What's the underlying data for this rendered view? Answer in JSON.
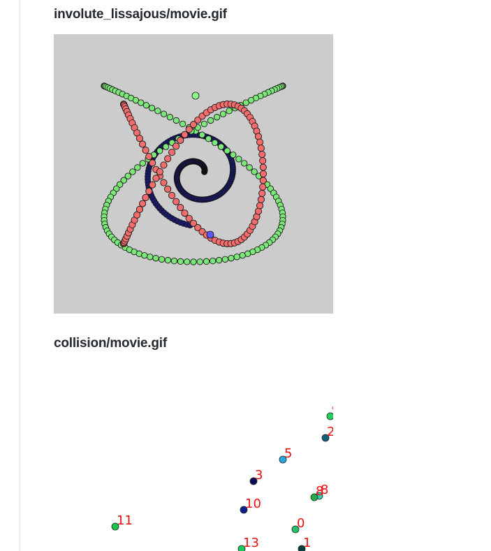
{
  "sections": [
    {
      "title": "involute_lissajous/movie.gif"
    },
    {
      "title": "collision/movie.gif"
    }
  ],
  "colors": {
    "frame_bg": "#cccccc",
    "red_dot": "#f26d6d",
    "green_dot": "#7de87a",
    "blue_dot": "#1b1b6b",
    "label_red": "#ee1111"
  },
  "particles": [
    {
      "label": "0",
      "fill": "#25c264"
    },
    {
      "label": "1",
      "fill": "#0c3d3d"
    },
    {
      "label": "2",
      "fill": "#135f7a"
    },
    {
      "label": "3",
      "fill": "#0d0d55"
    },
    {
      "label": "5",
      "fill": "#2aa7e0"
    },
    {
      "label": "8",
      "fill": "#2fcfb0"
    },
    {
      "label": "8",
      "fill": "#1fae4a"
    },
    {
      "label": "9",
      "fill": "#22d25a"
    },
    {
      "label": "10",
      "fill": "#0b1f8c"
    },
    {
      "label": "11",
      "fill": "#17c44a"
    },
    {
      "label": "13",
      "fill": "#1ec85a"
    }
  ]
}
